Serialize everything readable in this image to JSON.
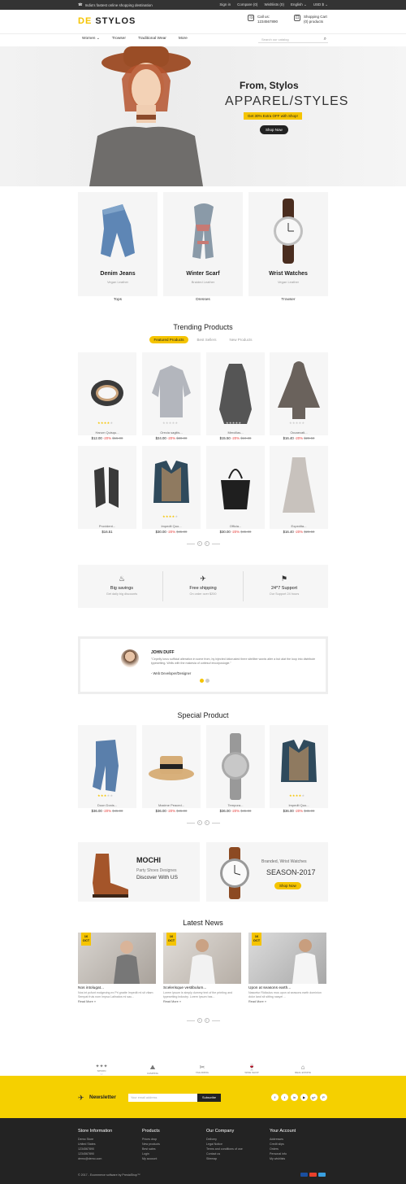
{
  "topbar": {
    "tagline": "India's fastest online shopping destination",
    "links": [
      "Sign in",
      "Compare (0)",
      "Wishlists (0)",
      "English ⌄",
      "USD $ ⌄"
    ]
  },
  "header": {
    "logo_a": "DE",
    "logo_b": " STYLOS",
    "call_label": "Call us:",
    "call_value": "1234567890",
    "cart_label": "Shopping Cart",
    "cart_value": "(0) products"
  },
  "nav": {
    "items": [
      "Women ⌄",
      "Trowser",
      "Traditional Wear",
      "More"
    ],
    "search_placeholder": "Search our catalog"
  },
  "hero": {
    "line1": "From, Stylos",
    "line2": "APPAREL/STYLES",
    "offer": "Get 30% Extra OFF with Shop!",
    "button": "Shop Now"
  },
  "categories": [
    {
      "title": "Denim Jeans",
      "sub": "Vegan Leather",
      "label": "Tops"
    },
    {
      "title": "Winter Scarf",
      "sub": "Braided Leather",
      "label": "Dresses"
    },
    {
      "title": "Wrist Watches",
      "sub": "Vegan Leather",
      "label": "Trowser"
    }
  ],
  "trending": {
    "title": "Trending Products",
    "tabs": [
      "Featured Products",
      "Best Sellers",
      "New Products"
    ],
    "products": [
      {
        "name": "Harum Quisqu...",
        "price": "$12.00",
        "disc": "-20%",
        "old": "$15.00",
        "stars": 4
      },
      {
        "name": "Orecia sagitis...",
        "price": "$24.00",
        "disc": "-20%",
        "old": "$30.00",
        "stars": 0
      },
      {
        "name": "Mercillas...",
        "price": "$15.50",
        "disc": "-20%",
        "old": "$19.38",
        "stars": 0
      },
      {
        "name": "Occaecati...",
        "price": "$16.40",
        "disc": "-20%",
        "old": "$20.50",
        "stars": 0
      },
      {
        "name": "Provident...",
        "price": "$16.51",
        "disc": "",
        "old": "",
        "stars": 0
      },
      {
        "name": "Impedit Quo...",
        "price": "$30.00",
        "disc": "-20%",
        "old": "$45.00",
        "stars": 4
      },
      {
        "name": "Officia...",
        "price": "$30.00",
        "disc": "-20%",
        "old": "$45.00",
        "stars": 0
      },
      {
        "name": "Expedita...",
        "price": "$16.40",
        "disc": "-20%",
        "old": "$20.50",
        "stars": 0
      }
    ]
  },
  "services": [
    {
      "title": "Big savings",
      "sub": "Get daily big discounts"
    },
    {
      "title": "Free shipping",
      "sub": "On order over $200"
    },
    {
      "title": "24*7 Support",
      "sub": "Our Support 24 hours"
    }
  ],
  "testimonial": {
    "name": "JOHN DUFF",
    "quote": "\"Cepelly lorus sufficial alteration in some from, by injected lotiorusted there sitelliter words alter a but alat the loop into distribute typesetting. Wells with the makesia of cottesuf encolposiogie.\"",
    "role": "- Web Developer/Designer"
  },
  "special": {
    "title": "Special Product",
    "products": [
      {
        "name": "Doon Donis...",
        "price": "$36.00",
        "disc": "-20%",
        "old": "$45.00",
        "stars": 3
      },
      {
        "name": "Maxime Peaced...",
        "price": "$36.00",
        "disc": "-20%",
        "old": "$45.00",
        "stars": 0
      },
      {
        "name": "Tempora...",
        "price": "$36.00",
        "disc": "-20%",
        "old": "$45.00",
        "stars": 0
      },
      {
        "name": "Impedit Quo...",
        "price": "$36.00",
        "disc": "-20%",
        "old": "$45.00",
        "stars": 4
      }
    ]
  },
  "banner1": {
    "title": "MOCHI",
    "sub1": "Party Shoes Designes",
    "sub2": "Discover With US"
  },
  "banner2": {
    "title": "Branded, Wrist Watches",
    "sub": "SEASON-2017",
    "button": "Shop Now"
  },
  "news": {
    "title": "Latest News",
    "posts": [
      {
        "day": "16",
        "month": "OCT",
        "title": "Nos intolugat...",
        "excerpt": "Nos int pcfunt eodgecing ex Pri gnatte Impedit ml sit vitam Sempat fruis nom Impsa Latinatos mi sau...",
        "more": "Read More »"
      },
      {
        "day": "16",
        "month": "OCT",
        "title": "Scelerisque vestibulum...",
        "excerpt": "Lorem Ipsum is simply dummy text of the printing and typesetting industry. Lorem Ipsum has...",
        "more": "Read More »"
      },
      {
        "day": "16",
        "month": "OCT",
        "title": "Upon at seasons earth...",
        "excerpt": "Nascetur Ridiculus mus upon at seasons earth dominion dolor land sit sitting nasyel ...",
        "more": "Read More »"
      }
    ]
  },
  "brands": [
    "SPOON",
    "CAMPING",
    "TAILORING",
    "WINE SHOP",
    "REAL ESTATE"
  ],
  "newsletter": {
    "label": "Newsletter",
    "placeholder": "Your email address",
    "button": "Subscribe",
    "social": [
      "f",
      "t",
      "in",
      "▶",
      "g+",
      "P"
    ]
  },
  "footer": {
    "store": {
      "title": "Store Information",
      "items": [
        "Demo Store",
        "United States",
        "1234567890",
        "1234567890",
        "demo@demo.com"
      ]
    },
    "products": {
      "title": "Products",
      "items": [
        "Prices drop",
        "New products",
        "Best sales",
        "Login",
        "My account"
      ]
    },
    "company": {
      "title": "Our Company",
      "items": [
        "Delivery",
        "Legal Notice",
        "Terms and conditions of use",
        "Contact us",
        "Sitemap"
      ]
    },
    "account": {
      "title": "Your Account",
      "items": [
        "Addresses",
        "Credit slips",
        "Orders",
        "Personal info",
        "My wishlists"
      ]
    },
    "copyright": "© 2017 - Ecommerce software by PrestaShop™"
  },
  "colors": {
    "accent": "#f5c400",
    "dark": "#232323"
  }
}
